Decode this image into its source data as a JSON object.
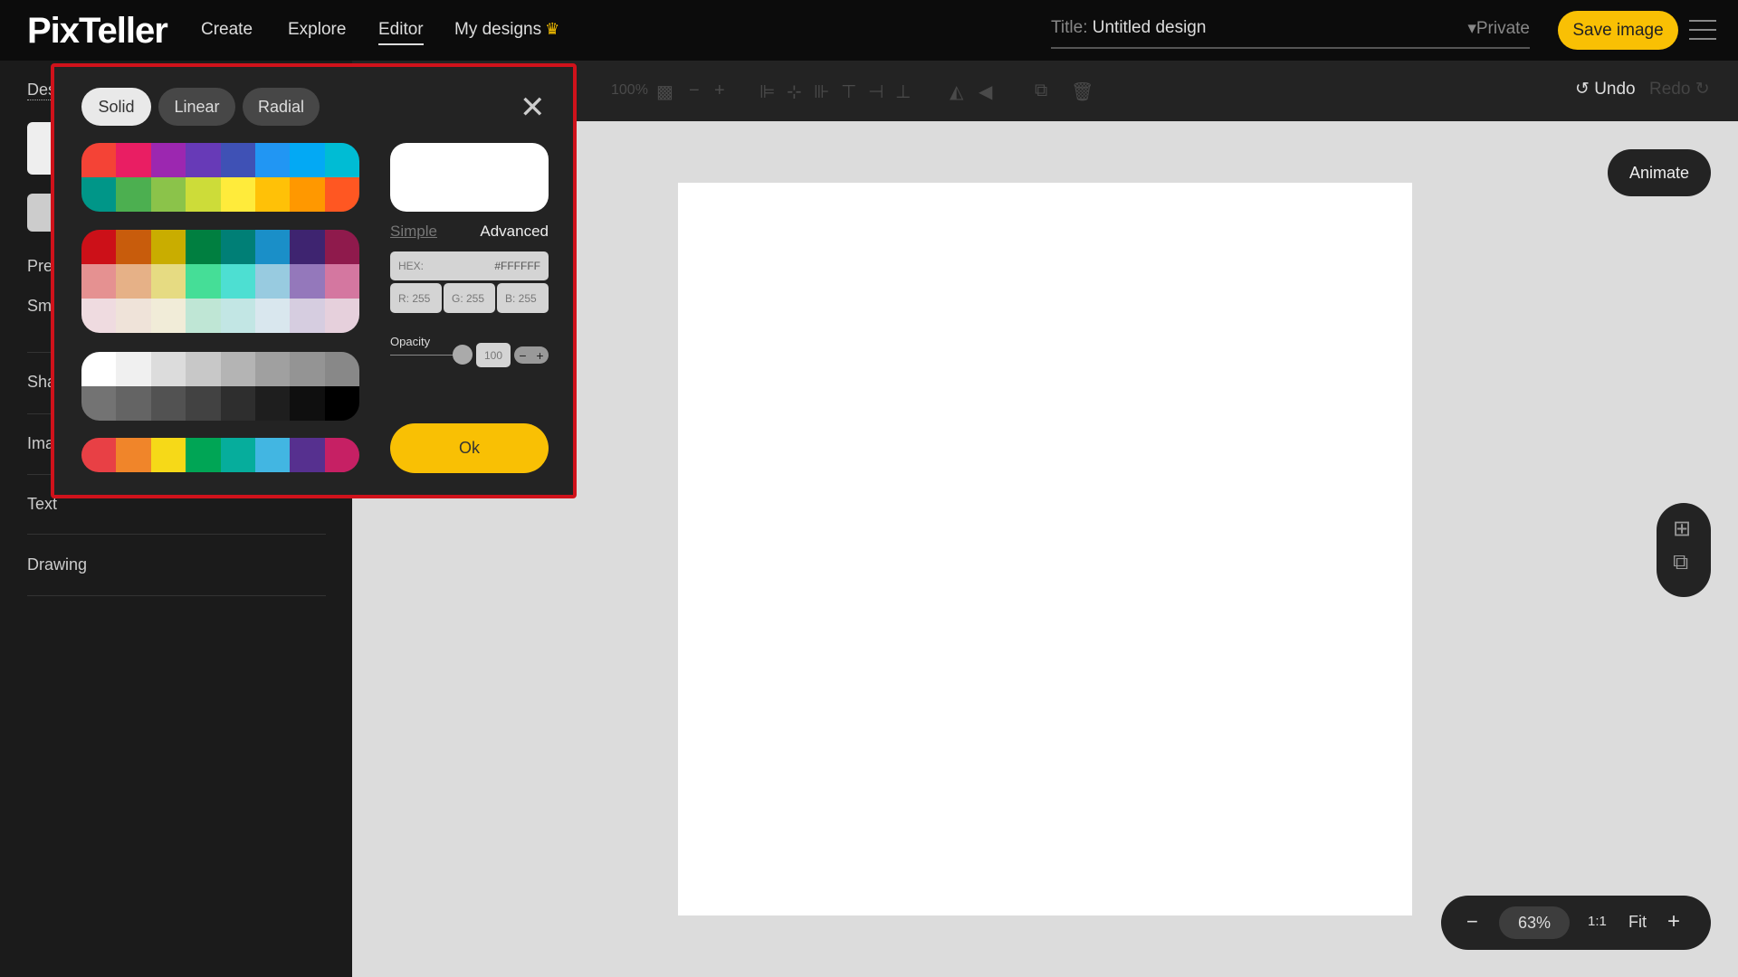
{
  "header": {
    "logo": "PixTeller",
    "nav": [
      "Create",
      "Explore",
      "Editor",
      "My designs"
    ],
    "title_label": "Title:",
    "title_value": "Untitled design",
    "privacy": "▾Private",
    "save": "Save image"
  },
  "toolbar": {
    "zoom": "100%",
    "undo": "Undo",
    "redo": "Redo"
  },
  "sidebar": {
    "items": [
      "Des",
      "Pre",
      "Sm",
      "Sha",
      "Ima",
      "Text",
      "Drawing"
    ]
  },
  "canvas": {
    "animate": "Animate",
    "zoom_value": "63%",
    "one_to_one": "1:1",
    "fit": "Fit",
    "minus": "−",
    "plus": "+"
  },
  "popup": {
    "tabs": [
      "Solid",
      "Linear",
      "Radial"
    ],
    "active_tab": "Solid",
    "simple": "Simple",
    "advanced": "Advanced",
    "hex_label": "HEX:",
    "hex_value": "#FFFFFF",
    "r": "R: 255",
    "g": "G: 255",
    "b": "B: 255",
    "opacity_label": "Opacity",
    "opacity_value": "100",
    "ok": "Ok",
    "selected_color": "#FFFFFF",
    "palettes": [
      [
        [
          "#f44336",
          "#e91e63",
          "#9c27b0",
          "#673ab7",
          "#3f51b5",
          "#2196f3",
          "#03a9f4",
          "#00bcd4"
        ],
        [
          "#009688",
          "#4caf50",
          "#8bc34a",
          "#cddc39",
          "#ffeb3b",
          "#ffc107",
          "#ff9800",
          "#ff5722"
        ]
      ],
      [
        [
          "#cc1018",
          "#c85c0c",
          "#c9ad00",
          "#007f40",
          "#007f76",
          "#1a8fc8",
          "#3e2470",
          "#8f1a4c"
        ],
        [
          "#e59191",
          "#e6b187",
          "#e6db82",
          "#45de97",
          "#4ddfd2",
          "#98cbe0",
          "#9478bb",
          "#d477a0"
        ],
        [
          "#efdbe0",
          "#efe3d9",
          "#f1ecd8",
          "#bfe6d5",
          "#c2e6e4",
          "#d9e7ee",
          "#d6cde0",
          "#e6d0dc"
        ]
      ],
      [
        [
          "#ffffff",
          "#f0f0f0",
          "#dcdcdc",
          "#c8c8c8",
          "#b4b4b4",
          "#a0a0a0",
          "#949494",
          "#888888"
        ],
        [
          "#737373",
          "#646464",
          "#525252",
          "#424242",
          "#2e2e2e",
          "#1e1e1e",
          "#0f0f0f",
          "#000000"
        ]
      ],
      [
        [
          "#e84045",
          "#f0852a",
          "#f6d918",
          "#00a555",
          "#06ad9c",
          "#42b6e2",
          "#56308f",
          "#c62064"
        ]
      ]
    ]
  }
}
